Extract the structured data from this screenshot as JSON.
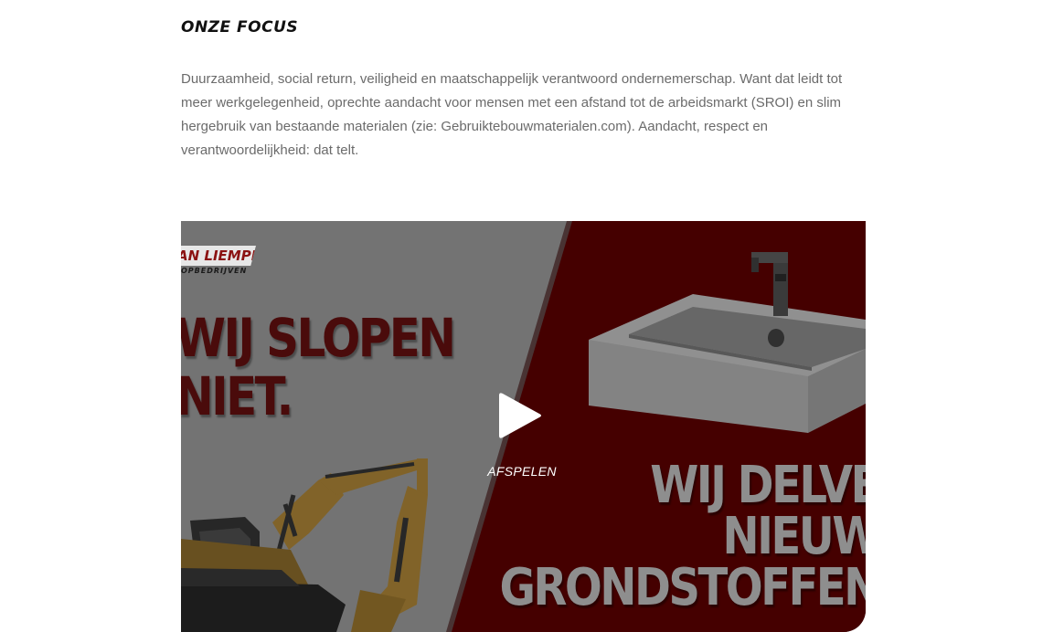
{
  "section": {
    "title": "ONZE FOCUS",
    "paragraph": "Duurzaamheid, social return, veiligheid en maatschappelijk verantwoord ondernemerschap. Want dat leidt tot meer werkgelegenheid, oprechte aandacht voor mensen met een afstand tot de arbeidsmarkt (SROI) en slim hergebruik van bestaande materialen (zie: Gebruiktebouwmaterialen.com). Aandacht, respect en verantwoordelijkheid: dat telt."
  },
  "video": {
    "logo_name": "AN LIEMPD",
    "logo_sub": "OPBEDRIJVEN",
    "slogan_left": "WIJ SLOPEN\nNIET.",
    "slogan_right": "WIJ DELVE\nNIEUW\nGRONDSTOFFEN",
    "play_label": "AFSPELEN",
    "play_icon": "play-icon",
    "colors": {
      "left_panel": "#7b7b7b",
      "right_panel": "#4a0000",
      "slogan_dark_red": "#4a0b0b",
      "slogan_grey": "#8e8e8e",
      "excavator": "#8a6a2c"
    }
  }
}
